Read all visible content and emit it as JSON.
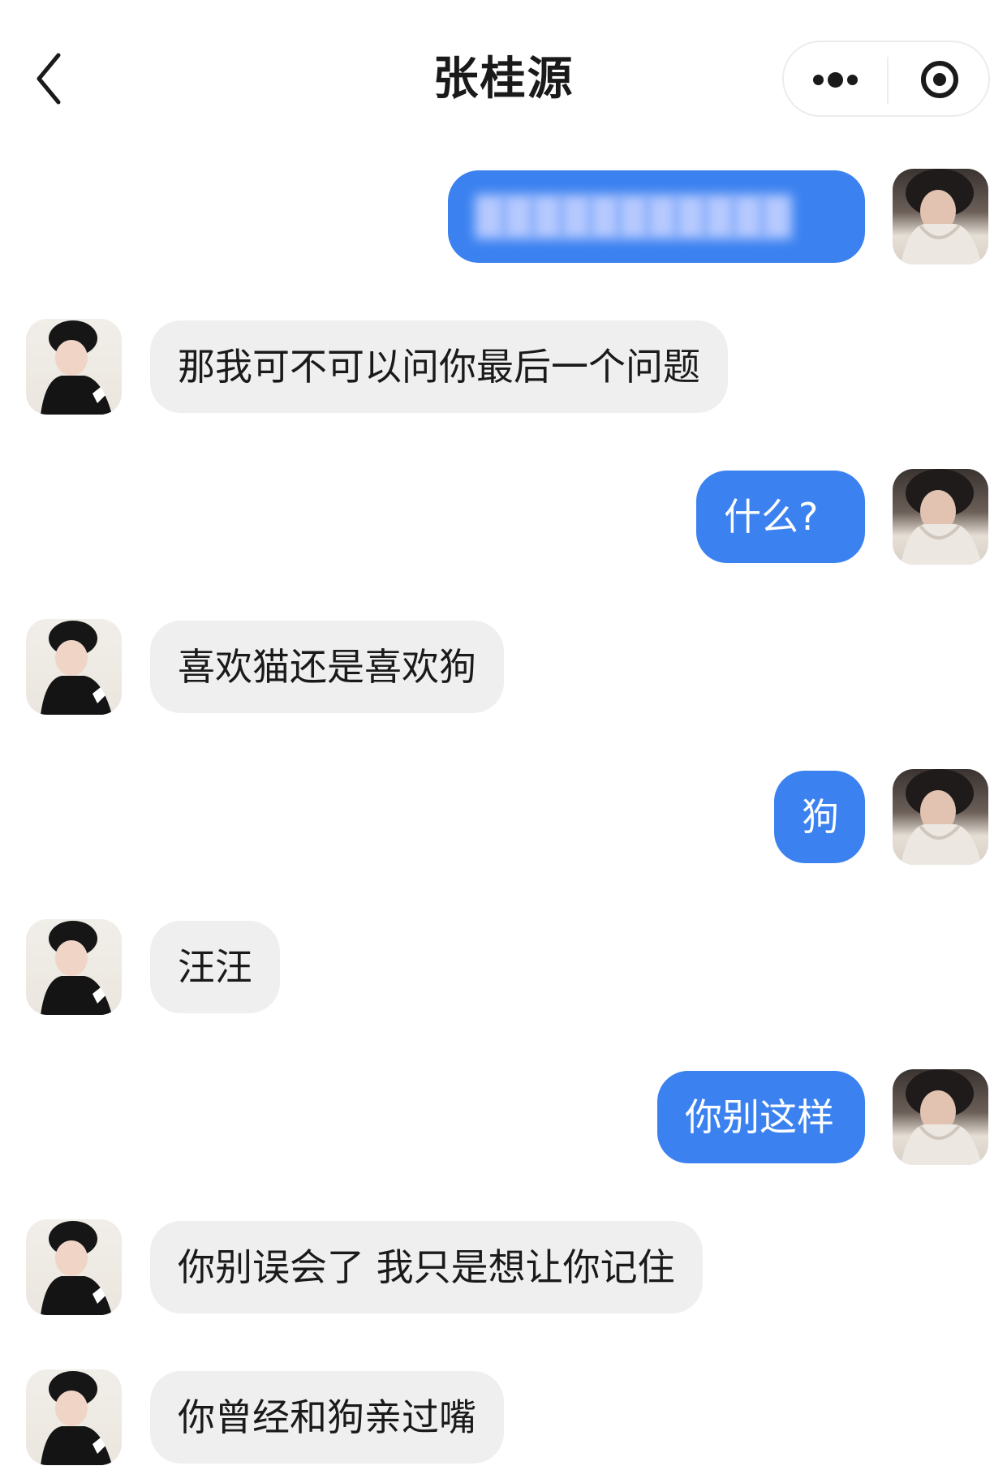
{
  "header": {
    "title": "张桂源",
    "back_icon": "chevron-left-icon",
    "more_icon": "more-dots-icon",
    "close_icon": "target-circle-icon"
  },
  "colors": {
    "outgoing_bubble": "#3b82f0",
    "incoming_bubble": "#efefef",
    "background": "#ffffff"
  },
  "messages": [
    {
      "side": "outgoing",
      "text": "",
      "blurred": true
    },
    {
      "side": "incoming",
      "text": "那我可不可以问你最后一个问题"
    },
    {
      "side": "outgoing",
      "text": "什么?"
    },
    {
      "side": "incoming",
      "text": "喜欢猫还是喜欢狗"
    },
    {
      "side": "outgoing",
      "text": "狗"
    },
    {
      "side": "incoming",
      "text": "汪汪"
    },
    {
      "side": "outgoing",
      "text": "你别这样"
    },
    {
      "side": "incoming",
      "text": "你别误会了 我只是想让你记住"
    },
    {
      "side": "incoming",
      "text": "你曾经和狗亲过嘴"
    }
  ]
}
